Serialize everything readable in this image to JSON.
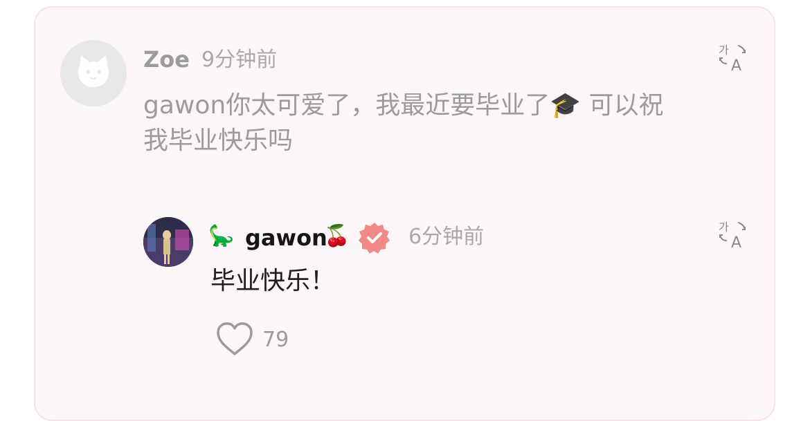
{
  "comment": {
    "author": "Zoe",
    "time": "9分钟前",
    "text": "gawon你太可爱了，我最近要毕业了🎓 可以祝我毕业快乐吗",
    "avatar_icon": "cat-avatar-icon"
  },
  "reply": {
    "name_prefix_emoji": "🦕",
    "author": "gawon",
    "name_suffix_emoji": "🍒",
    "verified_icon": "verified-badge-icon",
    "time": "6分钟前",
    "text": "毕业快乐！",
    "like_count": "79"
  },
  "colors": {
    "card_bg": "#fdf6f8",
    "card_border": "#f6e3ea",
    "muted_text": "#9b9b9b",
    "verified": "#f08a86"
  }
}
